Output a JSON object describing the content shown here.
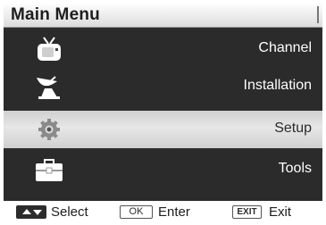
{
  "header": {
    "title": "Main Menu"
  },
  "menu": {
    "items": [
      {
        "label": "Channel",
        "icon": "tv-icon",
        "selected": false
      },
      {
        "label": "Installation",
        "icon": "satellite-dish-icon",
        "selected": false
      },
      {
        "label": "Setup",
        "icon": "gear-icon",
        "selected": true
      },
      {
        "label": "Tools",
        "icon": "toolbox-icon",
        "selected": false
      }
    ]
  },
  "footer": {
    "select_label": "Select",
    "ok_key": "OK",
    "enter_label": "Enter",
    "exit_key": "EXIT",
    "exit_label": "Exit"
  },
  "colors": {
    "panel": "#2b2b2b",
    "selected_row": "#e0e0e0",
    "title_bar": "#f0f0f0"
  }
}
